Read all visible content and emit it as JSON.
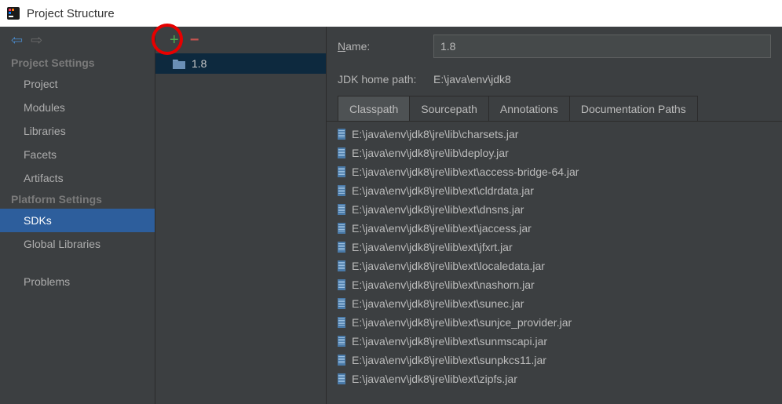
{
  "title": "Project Structure",
  "nav": {
    "project_settings_header": "Project Settings",
    "platform_settings_header": "Platform Settings",
    "items": {
      "project": "Project",
      "modules": "Modules",
      "libraries": "Libraries",
      "facets": "Facets",
      "artifacts": "Artifacts",
      "sdks": "SDKs",
      "global_libraries": "Global Libraries",
      "problems": "Problems"
    }
  },
  "sdk_list": {
    "selected": "1.8"
  },
  "details": {
    "name_label_pre": "N",
    "name_label_post": "ame:",
    "name_value": "1.8",
    "home_label": "JDK home path:",
    "home_value": "E:\\java\\env\\jdk8",
    "tabs": {
      "classpath": "Classpath",
      "sourcepath": "Sourcepath",
      "annotations": "Annotations",
      "docpaths": "Documentation Paths"
    },
    "classpath_items": [
      "E:\\java\\env\\jdk8\\jre\\lib\\charsets.jar",
      "E:\\java\\env\\jdk8\\jre\\lib\\deploy.jar",
      "E:\\java\\env\\jdk8\\jre\\lib\\ext\\access-bridge-64.jar",
      "E:\\java\\env\\jdk8\\jre\\lib\\ext\\cldrdata.jar",
      "E:\\java\\env\\jdk8\\jre\\lib\\ext\\dnsns.jar",
      "E:\\java\\env\\jdk8\\jre\\lib\\ext\\jaccess.jar",
      "E:\\java\\env\\jdk8\\jre\\lib\\ext\\jfxrt.jar",
      "E:\\java\\env\\jdk8\\jre\\lib\\ext\\localedata.jar",
      "E:\\java\\env\\jdk8\\jre\\lib\\ext\\nashorn.jar",
      "E:\\java\\env\\jdk8\\jre\\lib\\ext\\sunec.jar",
      "E:\\java\\env\\jdk8\\jre\\lib\\ext\\sunjce_provider.jar",
      "E:\\java\\env\\jdk8\\jre\\lib\\ext\\sunmscapi.jar",
      "E:\\java\\env\\jdk8\\jre\\lib\\ext\\sunpkcs11.jar",
      "E:\\java\\env\\jdk8\\jre\\lib\\ext\\zipfs.jar"
    ]
  }
}
